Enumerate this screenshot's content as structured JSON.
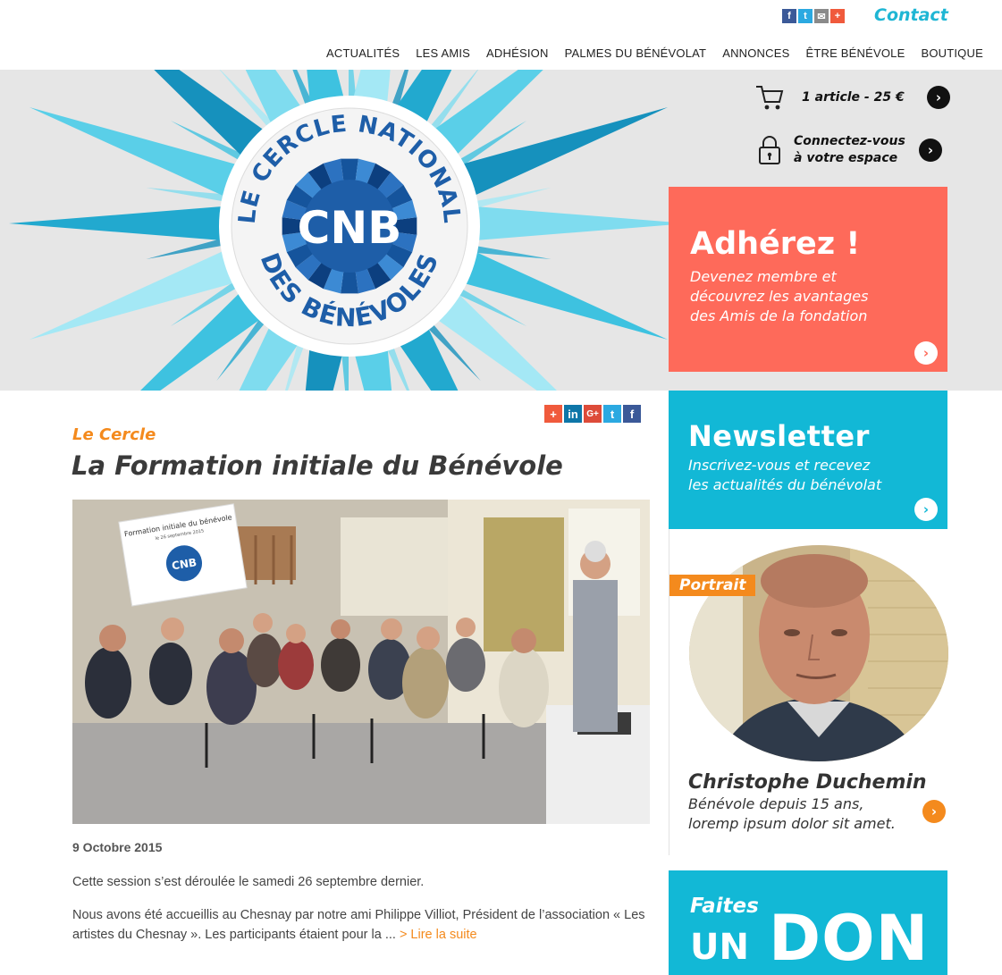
{
  "header": {
    "social_icons": [
      "facebook-icon",
      "twitter-icon",
      "mail-icon",
      "plus-icon"
    ],
    "contact_label": "Contact",
    "nav": [
      "ACTUALITÉS",
      "LES AMIS",
      "ADHÉSION",
      "PALMES DU BÉNÉVOLAT",
      "ANNONCES",
      "ÊTRE BÉNÉVOLE",
      "BOUTIQUE"
    ]
  },
  "hero": {
    "logo": {
      "arc_top": "LE CERCLE NATIONAL",
      "arc_bottom": "DES BÉNÉVOLES",
      "initials": "CNB"
    },
    "cart_text": "1 article - 25 €",
    "login_line1": "Connectez-vous",
    "login_line2": "à votre espace"
  },
  "sidebar": {
    "adherez": {
      "title": "Adhérez !",
      "line1": "Devenez membre et",
      "line2": "découvrez les avantages",
      "line3": "des Amis de la fondation"
    },
    "newsletter": {
      "title": "Newsletter",
      "line1": "Inscrivez-vous et recevez",
      "line2": "les actualités du bénévolat"
    },
    "portrait": {
      "tag": "Portrait",
      "name": "Christophe Duchemin",
      "line1": "Bénévole depuis 15 ans,",
      "line2": "loremp ipsum dolor sit amet."
    },
    "don": {
      "line1": "Faites",
      "line2a": "UN",
      "line2b": "DON"
    }
  },
  "article": {
    "share_icons": [
      "plus-icon",
      "linkedin-icon",
      "google-plus-icon",
      "twitter-icon",
      "facebook-icon"
    ],
    "category": "Le Cercle",
    "title": "La Formation initiale du Bénévole",
    "photo_sign": {
      "title": "Formation initiale du bénévole",
      "subtitle": "le 26 septembre 2015"
    },
    "date": "9 Octobre 2015",
    "paragraph1": "Cette session s’est déroulée le samedi 26 septembre dernier.",
    "paragraph2": "Nous avons été accueillis au Chesnay par notre ami Philippe Villiot, Président de l’association « Les artistes du Chesnay ». Les participants étaient pour la ... ",
    "read_more": "> Lire la suite"
  },
  "colors": {
    "accent_cyan": "#12b8d6",
    "coral": "#fe6a5a",
    "orange": "#f48a1d",
    "logo_blue": "#1e5ea8"
  }
}
